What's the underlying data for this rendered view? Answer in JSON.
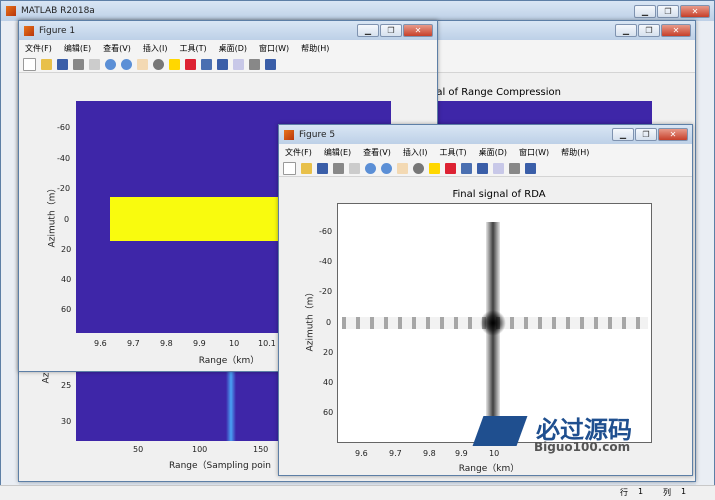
{
  "app": {
    "title": "MATLAB R2018a",
    "status_row_label": "行",
    "status_row": "1",
    "status_col_label": "列",
    "status_col": "1"
  },
  "menus": [
    "文件(F)",
    "编辑(E)",
    "查看(V)",
    "插入(I)",
    "工具(T)",
    "桌面(D)",
    "窗口(W)",
    "帮助(H)"
  ],
  "figure1": {
    "title": "Figure 1",
    "plot": {
      "xlabel": "Range（km）",
      "ylabel": "Azimuth（m）",
      "xticks": [
        "9.6",
        "9.7",
        "9.8",
        "9.9",
        "10",
        "10.1"
      ],
      "yticks": [
        "-60",
        "-40",
        "-20",
        "0",
        "20",
        "40",
        "60"
      ],
      "colors": {
        "background": "#3e26a8",
        "block": "#f9fb0e"
      }
    }
  },
  "figure_back": {
    "title_partial": "nal of Range Compression",
    "xlabel_partial": "Range（Sampling poin",
    "ylabel_partial": "Az",
    "xticks": [
      "50",
      "100",
      "150"
    ],
    "yticks": [
      "25",
      "30"
    ]
  },
  "figure5": {
    "title": "Figure 5",
    "plot": {
      "title": "Final signal of RDA",
      "xlabel": "Range（km）",
      "ylabel": "Azimuth（m）",
      "xticks": [
        "9.6",
        "9.7",
        "9.8",
        "9.9",
        "10"
      ],
      "yticks": [
        "-60",
        "-40",
        "-20",
        "0",
        "20",
        "40",
        "60"
      ]
    }
  },
  "watermark": {
    "line1": "必过源码",
    "line2": "Biguo100.com"
  }
}
